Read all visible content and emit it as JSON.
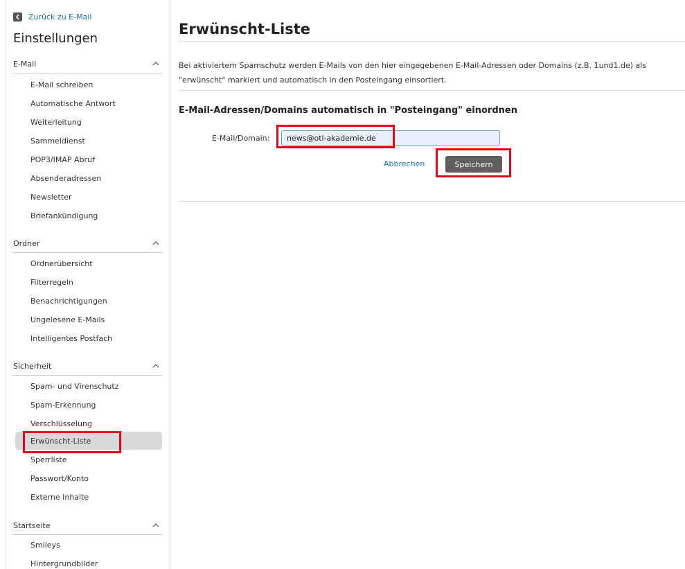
{
  "sidebar": {
    "back_label": "Zurück zu E-Mail",
    "title": "Einstellungen",
    "sections": [
      {
        "label": "E-Mail",
        "items": [
          "E-Mail schreiben",
          "Automatische Antwort",
          "Weiterleitung",
          "Sammeldienst",
          "POP3/IMAP Abruf",
          "Absenderadressen",
          "Newsletter",
          "Briefankündigung"
        ]
      },
      {
        "label": "Ordner",
        "items": [
          "Ordnerübersicht",
          "Filterregeln",
          "Benachrichtigungen",
          "Ungelesene E-Mails",
          "Intelligentes Postfach"
        ]
      },
      {
        "label": "Sicherheit",
        "items": [
          "Spam- und Virenschutz",
          "Spam-Erkennung",
          "Verschlüsselung",
          "Erwünscht-Liste",
          "Sperrliste",
          "Passwort/Konto",
          "Externe Inhalte"
        ]
      },
      {
        "label": "Startseite",
        "items": [
          "Smileys",
          "Hintergrundbilder"
        ]
      }
    ],
    "active_item": "Erwünscht-Liste"
  },
  "main": {
    "title": "Erwünscht-Liste",
    "description": "Bei aktiviertem Spamschutz werden E-Mails von den hier eingegebenen E-Mail-Adressen oder Domains (z.B. 1und1.de) als \"erwünscht\" markiert und automatisch in den Posteingang einsortiert.",
    "section_title": "E-Mail-Adressen/Domains automatisch in \"Posteingang\" einordnen",
    "field_label": "E-Mail/Domain:",
    "field_value": "news@otl-akademie.de",
    "cancel_label": "Abbrechen",
    "save_label": "Speichern"
  },
  "colors": {
    "link": "#1a73b8",
    "highlight_box": "#e2001a",
    "save_button_bg": "#5f5f5f",
    "active_item_bg": "#d9d9d9",
    "input_bg": "#e8f0fe"
  }
}
